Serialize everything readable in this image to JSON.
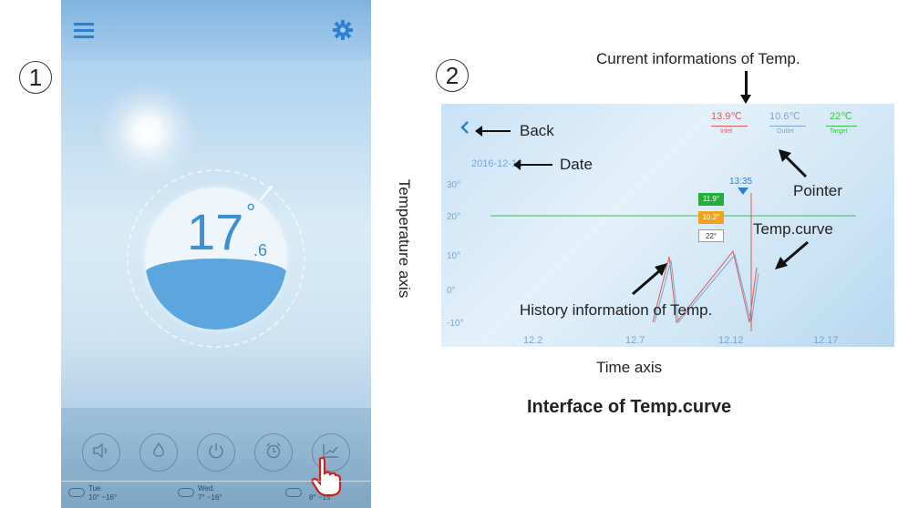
{
  "labels": {
    "circle_1": "1",
    "circle_2": "2"
  },
  "phone1": {
    "temp_main": "17",
    "temp_decimal": ".6",
    "temp_degree": "°",
    "weather": [
      {
        "day": "Tue.",
        "range": "10° ~16°"
      },
      {
        "day": "Wed.",
        "range": "7° ~16°"
      },
      {
        "day": "",
        "range": "8° ~15°"
      }
    ]
  },
  "phone2": {
    "date": "2016-12-12",
    "pointer_time": "13:35",
    "inlet_value": "13.9℃",
    "inlet_label": "Inlet",
    "outlet_value": "10.6℃",
    "outlet_label": "Outlet",
    "target_value": "22℃",
    "target_label": "Target",
    "y_ticks": [
      "30°",
      "20°",
      "10°",
      "0°",
      "-10°"
    ],
    "x_ticks": [
      "12.2",
      "12.7",
      "12.12",
      "12.17"
    ],
    "badge_green": "11.9°",
    "badge_orange": "10.2°",
    "badge_white": "22°"
  },
  "annotations": {
    "current_info": "Current informations of Temp.",
    "back": "Back",
    "date": "Date",
    "pointer": "Pointer",
    "temp_curve": "Temp.curve",
    "history": "History information of Temp.",
    "temperature_axis": "Temperature axis",
    "time_axis": "Time axis",
    "caption": "Interface of Temp.curve"
  },
  "colors": {
    "inlet": "#e05a5a",
    "outlet": "#7aa6cf",
    "target": "#3cc24a",
    "badge_green": "#22b03a",
    "badge_orange": "#f4a21a"
  }
}
